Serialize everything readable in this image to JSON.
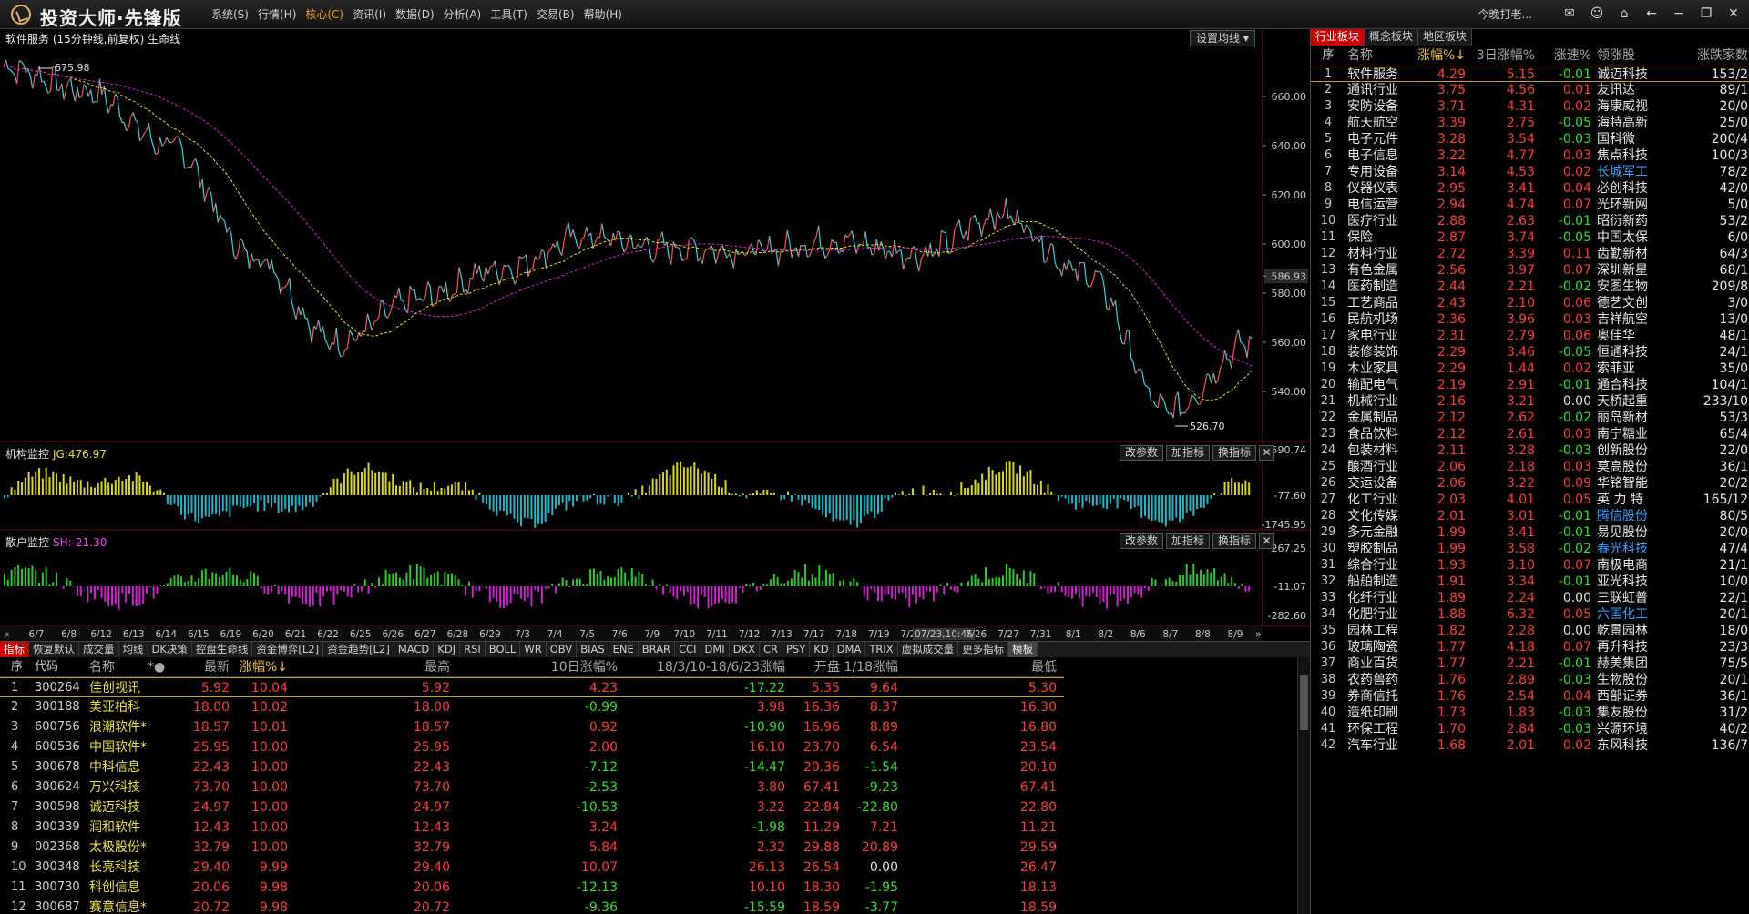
{
  "app": {
    "title": "投资大师·先锋版",
    "menu": [
      "系统(S)",
      "行情(H)",
      "核心(C)",
      "资讯(I)",
      "数据(D)",
      "分析(A)",
      "工具(T)",
      "交易(B)",
      "帮助(H)"
    ],
    "active_menu": "核心(C)",
    "greeting": "今晚打老..."
  },
  "chart": {
    "title": "软件服务 (15分钟线,前复权) 生命线",
    "ma_button": "设置均线",
    "high_label": "675.98",
    "low_label": "526.70",
    "price_axis": [
      "660.00",
      "640.00",
      "620.00",
      "600.00",
      "586.93",
      "580.00",
      "560.00",
      "540.00"
    ],
    "price_current": "586.93",
    "pane2": {
      "label": "机构监控",
      "value": "JG:476.97",
      "axis": [
        "1590.74",
        "-77.60",
        "-1745.95"
      ],
      "buttons": [
        "改参数",
        "加指标",
        "换指标"
      ]
    },
    "pane3": {
      "label": "散户监控",
      "value": "SH:-21.30",
      "axis": [
        "267.25",
        "-11.07",
        "-282.60"
      ],
      "buttons": [
        "改参数",
        "加指标",
        "换指标"
      ]
    },
    "date_labels": [
      "6/7",
      "6/8",
      "6/12",
      "6/13",
      "6/14",
      "6/15",
      "6/19",
      "6/20",
      "6/21",
      "6/22",
      "6/25",
      "6/26",
      "6/27",
      "6/28",
      "6/29",
      "7/3",
      "7/4",
      "7/5",
      "7/6",
      "7/9",
      "7/10",
      "7/11",
      "7/12",
      "7/13",
      "7/17",
      "7/18",
      "7/19",
      "7/20",
      "07/23,10:45",
      "7/26",
      "7/27",
      "7/31",
      "8/1",
      "8/2",
      "8/6",
      "8/7",
      "8/8",
      "8/9"
    ],
    "cursor_date": "07/23,10:45"
  },
  "chart_data": {
    "type": "line",
    "title": "软件服务 (15分钟线,前复权) 生命线",
    "x": [
      "6/7",
      "6/12",
      "6/15",
      "6/19",
      "6/22",
      "6/26",
      "6/29",
      "7/4",
      "7/9",
      "7/12",
      "7/17",
      "7/20",
      "7/26",
      "7/31",
      "8/6",
      "8/9"
    ],
    "series": [
      {
        "values": [
          672,
          662,
          640,
          595,
          560,
          578,
          590,
          603,
          598,
          597,
          601,
          596,
          612,
          588,
          532,
          560
        ]
      }
    ],
    "ylim": [
      520,
      680
    ],
    "high": 675.98,
    "low": 526.7
  },
  "indicator_tabs": [
    "指标",
    "恢复默认",
    "成交量",
    "均线",
    "DK决策",
    "控盘生命线",
    "资金博弈[L2]",
    "资金趋势[L2]",
    "MACD",
    "KDJ",
    "RSI",
    "BOLL",
    "WR",
    "OBV",
    "BIAS",
    "ENE",
    "BRAR",
    "CCI",
    "DMI",
    "DKX",
    "CR",
    "PSY",
    "KD",
    "DMA",
    "TRIX",
    "虚拟成交量",
    "更多指标",
    "模板"
  ],
  "stock_table": {
    "headers": {
      "idx": "序",
      "code": "代码",
      "name": "名称",
      "star": "*●",
      "last": "最新",
      "chg": "涨幅%↓",
      "high": "最高",
      "d10": "10日涨幅%",
      "range": "18/3/10-18/6/23涨幅",
      "open": "开盘",
      "r118": "1/18涨幅",
      "low": "最低"
    },
    "rows": [
      {
        "idx": "1",
        "code": "300264",
        "name": "佳创视讯",
        "last": "5.92",
        "chg": "10.04",
        "high": "5.92",
        "d10": "4.23",
        "range": "-17.22",
        "open": "5.35",
        "r118": "9.64",
        "low": "5.30"
      },
      {
        "idx": "2",
        "code": "300188",
        "name": "美亚柏科",
        "last": "18.00",
        "chg": "10.02",
        "high": "18.00",
        "d10": "-0.99",
        "range": "3.98",
        "open": "16.36",
        "r118": "8.37",
        "low": "16.30"
      },
      {
        "idx": "3",
        "code": "600756",
        "name": "浪潮软件*",
        "last": "18.57",
        "chg": "10.01",
        "high": "18.57",
        "d10": "0.92",
        "range": "-10.90",
        "open": "16.96",
        "r118": "8.89",
        "low": "16.80"
      },
      {
        "idx": "4",
        "code": "600536",
        "name": "中国软件*",
        "last": "25.95",
        "chg": "10.00",
        "high": "25.95",
        "d10": "2.00",
        "range": "16.10",
        "open": "23.70",
        "r118": "6.54",
        "low": "23.54"
      },
      {
        "idx": "5",
        "code": "300678",
        "name": "中科信息",
        "last": "22.43",
        "chg": "10.00",
        "high": "22.43",
        "d10": "-7.12",
        "range": "-14.47",
        "open": "20.36",
        "r118": "-1.54",
        "low": "20.10"
      },
      {
        "idx": "6",
        "code": "300624",
        "name": "万兴科技",
        "last": "73.70",
        "chg": "10.00",
        "high": "73.70",
        "d10": "-2.53",
        "range": "3.80",
        "open": "67.41",
        "r118": "-9.23",
        "low": "67.41"
      },
      {
        "idx": "7",
        "code": "300598",
        "name": "诚迈科技",
        "last": "24.97",
        "chg": "10.00",
        "high": "24.97",
        "d10": "-10.53",
        "range": "3.22",
        "open": "22.84",
        "r118": "-22.80",
        "low": "22.80"
      },
      {
        "idx": "8",
        "code": "300339",
        "name": "润和软件",
        "last": "12.43",
        "chg": "10.00",
        "high": "12.43",
        "d10": "3.24",
        "range": "-1.98",
        "open": "11.29",
        "r118": "7.21",
        "low": "11.21"
      },
      {
        "idx": "9",
        "code": "002368",
        "name": "太极股份*",
        "last": "32.79",
        "chg": "10.00",
        "high": "32.79",
        "d10": "5.84",
        "range": "2.32",
        "open": "29.88",
        "r118": "20.89",
        "low": "29.59"
      },
      {
        "idx": "10",
        "code": "300348",
        "name": "长亮科技",
        "last": "29.40",
        "chg": "9.99",
        "high": "29.40",
        "d10": "10.07",
        "range": "26.13",
        "open": "26.54",
        "r118": "0.00",
        "low": "26.47"
      },
      {
        "idx": "11",
        "code": "300730",
        "name": "科创信息",
        "last": "20.06",
        "chg": "9.98",
        "high": "20.06",
        "d10": "-12.13",
        "range": "10.10",
        "open": "18.30",
        "r118": "-1.95",
        "low": "18.13"
      },
      {
        "idx": "12",
        "code": "300687",
        "name": "赛意信息*",
        "last": "20.72",
        "chg": "9.98",
        "high": "20.72",
        "d10": "-9.36",
        "range": "-15.59",
        "open": "18.59",
        "r118": "-3.77",
        "low": "18.59"
      }
    ]
  },
  "sector_panel": {
    "tabs": [
      "行业板块",
      "概念板块",
      "地区板块"
    ],
    "headers": {
      "idx": "序",
      "name": "名称",
      "chg": "涨幅%↓",
      "d3": "3日涨幅%",
      "spd": "涨速%",
      "lead": "领涨股",
      "ud": "涨跌家数"
    },
    "rows": [
      {
        "idx": "1",
        "name": "软件服务",
        "chg": "4.29",
        "d3": "5.15",
        "spd": "-0.01",
        "lead": "诚迈科技",
        "ud": "153/2"
      },
      {
        "idx": "2",
        "name": "通讯行业",
        "chg": "3.75",
        "d3": "4.56",
        "spd": "0.01",
        "lead": "友讯达",
        "ud": "89/1"
      },
      {
        "idx": "3",
        "name": "安防设备",
        "chg": "3.71",
        "d3": "4.31",
        "spd": "0.02",
        "lead": "海康威视",
        "ud": "20/0"
      },
      {
        "idx": "4",
        "name": "航天航空",
        "chg": "3.39",
        "d3": "2.75",
        "spd": "-0.05",
        "lead": "海特高新",
        "ud": "25/0"
      },
      {
        "idx": "5",
        "name": "电子元件",
        "chg": "3.28",
        "d3": "3.54",
        "spd": "-0.03",
        "lead": "国科微",
        "ud": "200/4"
      },
      {
        "idx": "6",
        "name": "电子信息",
        "chg": "3.22",
        "d3": "4.77",
        "spd": "0.03",
        "lead": "焦点科技",
        "ud": "100/3"
      },
      {
        "idx": "7",
        "name": "专用设备",
        "chg": "3.14",
        "d3": "4.53",
        "spd": "0.02",
        "lead": "长城军工",
        "ud": "78/2",
        "blue": true
      },
      {
        "idx": "8",
        "name": "仪器仪表",
        "chg": "2.95",
        "d3": "3.41",
        "spd": "0.04",
        "lead": "必创科技",
        "ud": "42/0"
      },
      {
        "idx": "9",
        "name": "电信运营",
        "chg": "2.94",
        "d3": "4.74",
        "spd": "0.07",
        "lead": "光环新网",
        "ud": "5/0"
      },
      {
        "idx": "10",
        "name": "医疗行业",
        "chg": "2.88",
        "d3": "2.63",
        "spd": "-0.01",
        "lead": "昭衍新药",
        "ud": "53/2"
      },
      {
        "idx": "11",
        "name": "保险",
        "chg": "2.87",
        "d3": "3.74",
        "spd": "-0.05",
        "lead": "中国太保",
        "ud": "6/0"
      },
      {
        "idx": "12",
        "name": "材料行业",
        "chg": "2.72",
        "d3": "3.39",
        "spd": "0.11",
        "lead": "齿勤新材",
        "ud": "64/3"
      },
      {
        "idx": "13",
        "name": "有色金属",
        "chg": "2.56",
        "d3": "3.97",
        "spd": "0.07",
        "lead": "深圳新星",
        "ud": "68/1"
      },
      {
        "idx": "14",
        "name": "医药制造",
        "chg": "2.44",
        "d3": "2.21",
        "spd": "-0.02",
        "lead": "安图生物",
        "ud": "209/8"
      },
      {
        "idx": "15",
        "name": "工艺商品",
        "chg": "2.43",
        "d3": "2.10",
        "spd": "0.06",
        "lead": "德艺文创",
        "ud": "3/0"
      },
      {
        "idx": "16",
        "name": "民航机场",
        "chg": "2.36",
        "d3": "3.96",
        "spd": "0.03",
        "lead": "吉祥航空",
        "ud": "13/0"
      },
      {
        "idx": "17",
        "name": "家电行业",
        "chg": "2.31",
        "d3": "2.79",
        "spd": "0.06",
        "lead": "奥佳华",
        "ud": "48/1"
      },
      {
        "idx": "18",
        "name": "装修装饰",
        "chg": "2.29",
        "d3": "3.46",
        "spd": "-0.05",
        "lead": "恒通科技",
        "ud": "24/1"
      },
      {
        "idx": "19",
        "name": "木业家具",
        "chg": "2.29",
        "d3": "1.44",
        "spd": "0.02",
        "lead": "索菲亚",
        "ud": "35/0"
      },
      {
        "idx": "20",
        "name": "输配电气",
        "chg": "2.19",
        "d3": "2.91",
        "spd": "-0.01",
        "lead": "通合科技",
        "ud": "104/1"
      },
      {
        "idx": "21",
        "name": "机械行业",
        "chg": "2.16",
        "d3": "3.21",
        "spd": "0.00",
        "lead": "天桥起重",
        "ud": "233/10"
      },
      {
        "idx": "22",
        "name": "金属制品",
        "chg": "2.12",
        "d3": "2.62",
        "spd": "-0.02",
        "lead": "丽岛新材",
        "ud": "53/3"
      },
      {
        "idx": "23",
        "name": "食品饮料",
        "chg": "2.12",
        "d3": "2.61",
        "spd": "0.03",
        "lead": "南宁糖业",
        "ud": "65/4"
      },
      {
        "idx": "24",
        "name": "包装材料",
        "chg": "2.11",
        "d3": "3.28",
        "spd": "-0.03",
        "lead": "创新股份",
        "ud": "22/0"
      },
      {
        "idx": "25",
        "name": "酿酒行业",
        "chg": "2.06",
        "d3": "2.18",
        "spd": "0.03",
        "lead": "莫高股份",
        "ud": "36/1"
      },
      {
        "idx": "26",
        "name": "交运设备",
        "chg": "2.06",
        "d3": "3.22",
        "spd": "0.09",
        "lead": "华铭智能",
        "ud": "20/2"
      },
      {
        "idx": "27",
        "name": "化工行业",
        "chg": "2.03",
        "d3": "4.01",
        "spd": "0.05",
        "lead": "英 力 特",
        "ud": "165/12"
      },
      {
        "idx": "28",
        "name": "文化传媒",
        "chg": "2.01",
        "d3": "3.01",
        "spd": "-0.01",
        "lead": "腾信股份",
        "ud": "80/5",
        "blue": true
      },
      {
        "idx": "29",
        "name": "多元金融",
        "chg": "1.99",
        "d3": "3.41",
        "spd": "-0.01",
        "lead": "易见股份",
        "ud": "20/0"
      },
      {
        "idx": "30",
        "name": "塑胶制品",
        "chg": "1.99",
        "d3": "3.58",
        "spd": "-0.02",
        "lead": "春光科技",
        "ud": "47/4",
        "blue": true
      },
      {
        "idx": "31",
        "name": "综合行业",
        "chg": "1.93",
        "d3": "3.10",
        "spd": "0.07",
        "lead": "南极电商",
        "ud": "21/1"
      },
      {
        "idx": "32",
        "name": "船舶制造",
        "chg": "1.91",
        "d3": "3.34",
        "spd": "-0.01",
        "lead": "亚光科技",
        "ud": "10/0"
      },
      {
        "idx": "33",
        "name": "化纤行业",
        "chg": "1.89",
        "d3": "2.24",
        "spd": "0.00",
        "lead": "三联虹普",
        "ud": "22/1"
      },
      {
        "idx": "34",
        "name": "化肥行业",
        "chg": "1.88",
        "d3": "6.32",
        "spd": "0.05",
        "lead": "六国化工",
        "ud": "20/1",
        "blue": true
      },
      {
        "idx": "35",
        "name": "园林工程",
        "chg": "1.82",
        "d3": "2.28",
        "spd": "0.00",
        "lead": "乾景园林",
        "ud": "18/0"
      },
      {
        "idx": "36",
        "name": "玻璃陶瓷",
        "chg": "1.77",
        "d3": "4.18",
        "spd": "0.07",
        "lead": "再升科技",
        "ud": "23/3"
      },
      {
        "idx": "37",
        "name": "商业百货",
        "chg": "1.77",
        "d3": "2.21",
        "spd": "-0.01",
        "lead": "赫美集团",
        "ud": "75/5"
      },
      {
        "idx": "38",
        "name": "农药兽药",
        "chg": "1.76",
        "d3": "2.89",
        "spd": "-0.03",
        "lead": "生物股份",
        "ud": "20/1"
      },
      {
        "idx": "39",
        "name": "券商信托",
        "chg": "1.76",
        "d3": "2.54",
        "spd": "0.04",
        "lead": "西部证券",
        "ud": "36/1"
      },
      {
        "idx": "40",
        "name": "造纸印刷",
        "chg": "1.73",
        "d3": "1.83",
        "spd": "-0.03",
        "lead": "集友股份",
        "ud": "31/2"
      },
      {
        "idx": "41",
        "name": "环保工程",
        "chg": "1.70",
        "d3": "2.84",
        "spd": "-0.03",
        "lead": "兴源环境",
        "ud": "40/2"
      },
      {
        "idx": "42",
        "name": "汽车行业",
        "chg": "1.68",
        "d3": "2.01",
        "spd": "0.02",
        "lead": "东风科技",
        "ud": "136/7"
      }
    ]
  }
}
